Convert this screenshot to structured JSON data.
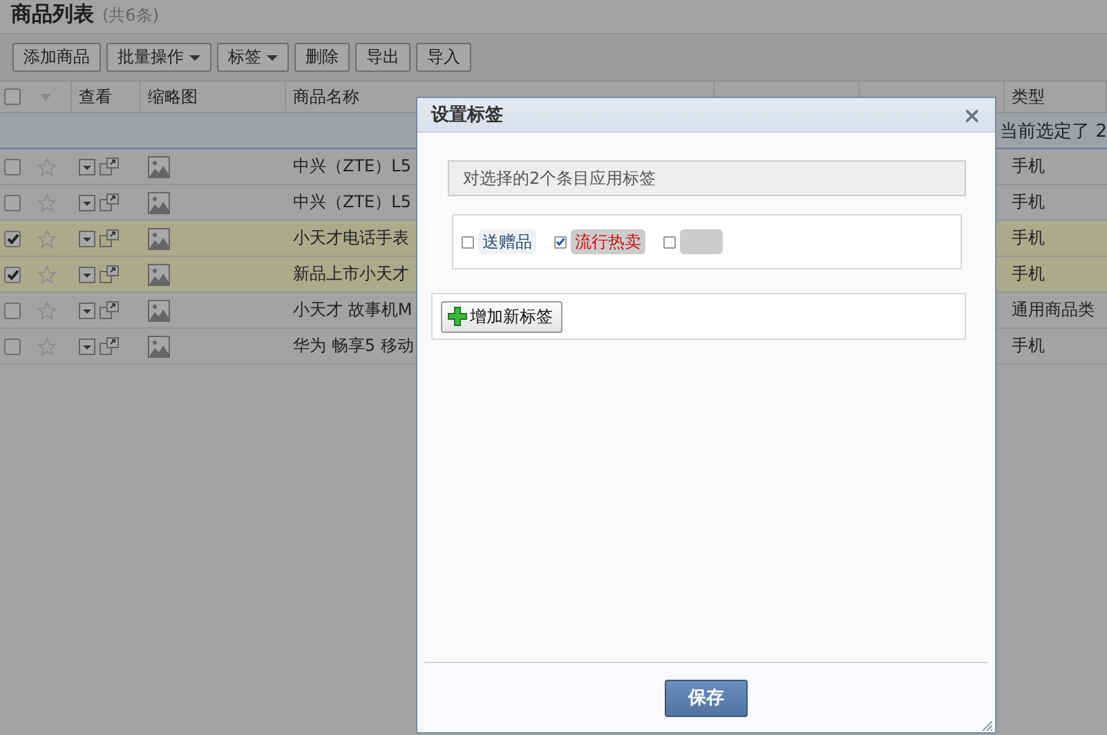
{
  "page": {
    "title": "商品列表",
    "count": "(共6条)"
  },
  "toolbar": [
    {
      "label": "添加商品",
      "dropdown": false
    },
    {
      "label": "批量操作",
      "dropdown": true
    },
    {
      "label": "标签",
      "dropdown": true
    },
    {
      "label": "删除",
      "dropdown": false
    },
    {
      "label": "导出",
      "dropdown": false
    },
    {
      "label": "导入",
      "dropdown": false
    }
  ],
  "table": {
    "select_all": false,
    "columns": [
      "查看",
      "缩略图",
      "商品名称",
      "类型"
    ],
    "selection_notice": "当前选定了 2",
    "rows": [
      {
        "checked": false,
        "name": "中兴（ZTE）L5",
        "type": "手机"
      },
      {
        "checked": false,
        "name": "中兴（ZTE）L5",
        "type": "手机"
      },
      {
        "checked": true,
        "name": "小天才电话手表",
        "type": "手机"
      },
      {
        "checked": true,
        "name": "新品上市小天才",
        "type": "手机"
      },
      {
        "checked": false,
        "name": "小天才 故事机M",
        "type": "通用商品类"
      },
      {
        "checked": false,
        "name": "华为 畅享5 移动",
        "type": "手机"
      }
    ]
  },
  "dialog": {
    "title": "设置标签",
    "close": "×",
    "info": "对选择的2个条目应用标签",
    "tags": [
      {
        "label": "送赠品",
        "checked": false,
        "color": "#eef2f6"
      },
      {
        "label": "流行热卖",
        "checked": true,
        "color": "#cccccc"
      },
      {
        "checked": false,
        "color": "#cccccc"
      }
    ],
    "add_button": "增加新标签",
    "save_button": "保存"
  }
}
